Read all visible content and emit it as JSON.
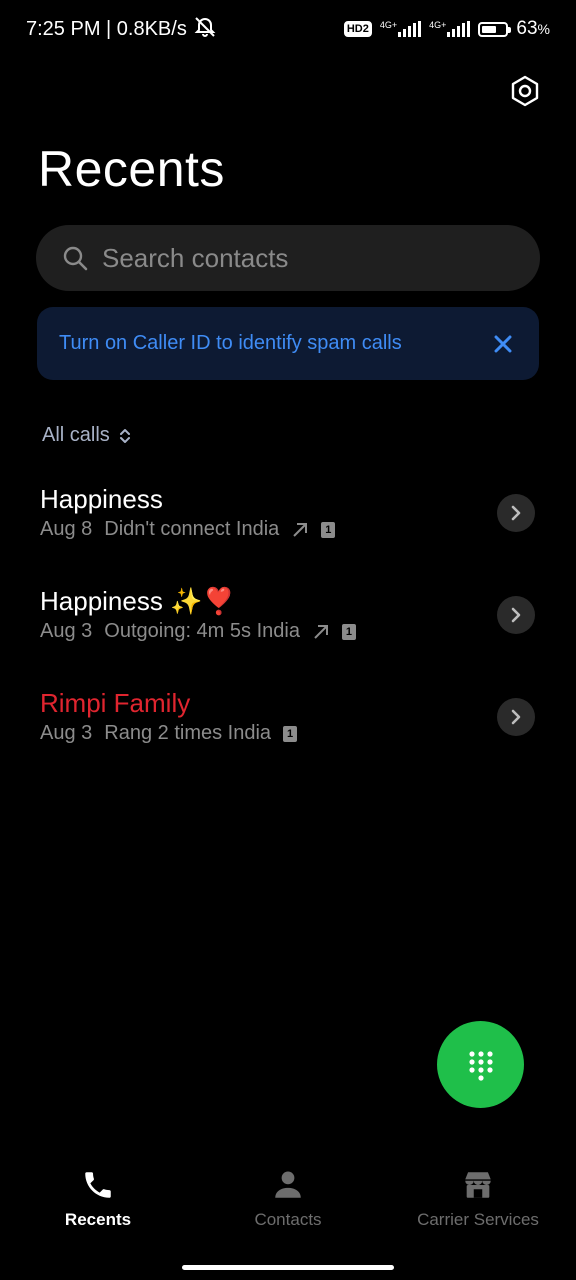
{
  "status_bar": {
    "time_and_speed": "7:25 PM | 0.8KB/s",
    "hd_badge": "HD2",
    "network1": "4G+",
    "network2": "4G+",
    "battery_level": 0.63,
    "battery_text": "63",
    "battery_unit": "%"
  },
  "header": {
    "title": "Recents"
  },
  "search": {
    "placeholder": "Search contacts"
  },
  "caller_id_banner": {
    "text": "Turn on Caller ID to identify spam calls",
    "accent_color": "#3f8cf5"
  },
  "filter": {
    "label": "All calls"
  },
  "calls": [
    {
      "name": "Happiness",
      "date": "Aug 8",
      "status": "Didn't connect India",
      "direction": "outgoing",
      "sim": "1",
      "missed": false
    },
    {
      "name": "Happiness ✨❣️",
      "date": "Aug 3",
      "status": "Outgoing: 4m 5s India",
      "direction": "outgoing",
      "sim": "1",
      "missed": false
    },
    {
      "name": "Rimpi Family",
      "date": "Aug 3",
      "status": "Rang 2 times India",
      "direction": "none",
      "sim": "1",
      "missed": true
    }
  ],
  "bottom_nav": {
    "recents": "Recents",
    "contacts": "Contacts",
    "carrier_services": "Carrier Services"
  },
  "colors": {
    "background": "#000000",
    "fab": "#1fbf4a",
    "missed": "#e0252f"
  }
}
